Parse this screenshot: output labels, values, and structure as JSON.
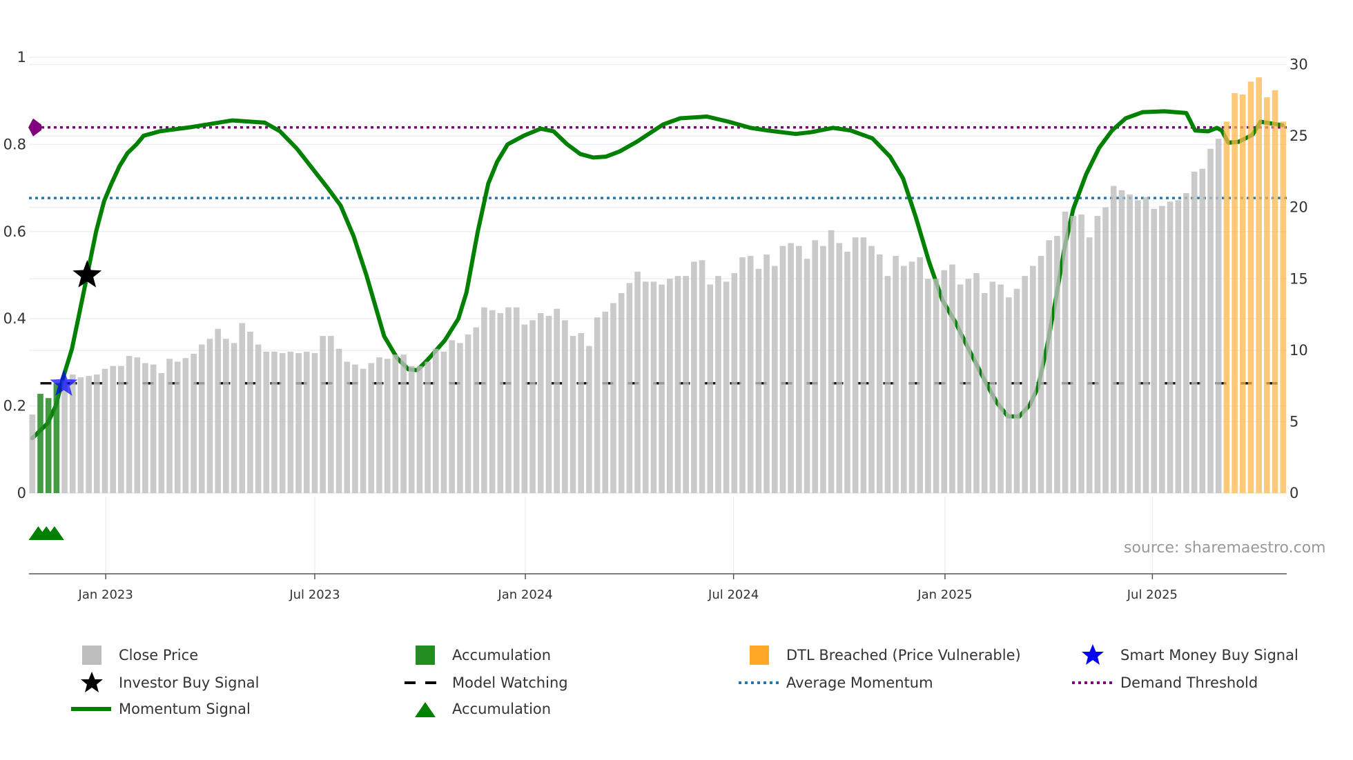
{
  "chart_data": {
    "type": "bar",
    "title": "",
    "xlabel": "",
    "ylabel_left": "",
    "ylabel_right": "",
    "x_unit": "week index (weekly bars, approx. Oct 2022 to Oct 2025)",
    "x_ticks": [
      {
        "label": "Jan 2023",
        "index": 9.1
      },
      {
        "label": "Jul 2023",
        "index": 35.0
      },
      {
        "label": "Jan 2024",
        "index": 61.1
      },
      {
        "label": "Jul 2024",
        "index": 86.9
      },
      {
        "label": "Jan 2025",
        "index": 113.1
      },
      {
        "label": "Jul 2025",
        "index": 138.8
      }
    ],
    "left_axis": {
      "range": [
        0,
        1
      ],
      "ticks": [
        "0",
        "0.2",
        "0.4",
        "0.6",
        "0.8",
        "1"
      ],
      "tick_values": [
        0,
        0.2,
        0.4,
        0.6,
        0.8,
        1
      ]
    },
    "right_axis": {
      "range": [
        0,
        30
      ],
      "ticks": [
        "0",
        "5",
        "10",
        "15",
        "20",
        "25",
        "30"
      ],
      "tick_values": [
        0,
        5,
        10,
        15,
        20,
        25,
        30
      ]
    },
    "grid": true,
    "close_prices": [
      5.5,
      6.95,
      6.65,
      7.7,
      7.9,
      8.3,
      8.1,
      8.2,
      8.3,
      8.7,
      8.9,
      8.9,
      9.6,
      9.5,
      9.1,
      9.0,
      8.4,
      9.4,
      9.2,
      9.45,
      9.75,
      10.4,
      10.8,
      11.5,
      10.8,
      10.5,
      11.9,
      11.3,
      10.4,
      9.9,
      9.9,
      9.8,
      9.9,
      9.8,
      9.9,
      9.8,
      11.0,
      11.0,
      10.1,
      9.2,
      9.0,
      8.7,
      9.1,
      9.5,
      9.4,
      9.7,
      9.7,
      8.9,
      8.9,
      9.2,
      10.1,
      9.9,
      10.7,
      10.5,
      11.1,
      11.6,
      13.0,
      12.8,
      12.6,
      13.0,
      13.0,
      11.8,
      12.1,
      12.6,
      12.4,
      12.9,
      12.1,
      11.0,
      11.2,
      10.3,
      12.3,
      12.7,
      13.3,
      14.0,
      14.7,
      15.5,
      14.8,
      14.8,
      14.6,
      15.0,
      15.2,
      15.2,
      16.2,
      16.3,
      14.6,
      15.2,
      14.8,
      15.4,
      16.5,
      16.6,
      15.7,
      16.7,
      15.9,
      17.3,
      17.5,
      17.3,
      16.4,
      17.7,
      17.3,
      18.4,
      17.5,
      16.9,
      17.9,
      17.9,
      17.3,
      16.7,
      15.2,
      16.6,
      15.9,
      16.2,
      16.5,
      15.0,
      15.0,
      15.6,
      16.0,
      14.6,
      15.0,
      15.4,
      14.0,
      14.8,
      14.6,
      13.7,
      14.3,
      15.2,
      15.9,
      16.6,
      17.7,
      18.0,
      19.7,
      19.4,
      19.5,
      17.9,
      19.4,
      20.0,
      21.5,
      21.2,
      20.9,
      20.5,
      20.7,
      19.9,
      20.1,
      20.4,
      20.5,
      21.0,
      22.5,
      22.7,
      24.1,
      24.8,
      26.0,
      28.0,
      27.9,
      28.8,
      29.1,
      27.7,
      28.2,
      26.0
    ],
    "accumulation_bars": [
      1,
      2,
      3
    ],
    "dtl_breached_bars": [
      148,
      149,
      150,
      151,
      152,
      153,
      154,
      155
    ],
    "momentum_signal": [
      [
        0,
        0.126
      ],
      [
        1.9,
        0.16
      ],
      [
        2.9,
        0.2
      ],
      [
        3.9,
        0.27
      ],
      [
        4.9,
        0.33
      ],
      [
        5.8,
        0.41
      ],
      [
        6.8,
        0.5
      ],
      [
        7.9,
        0.6
      ],
      [
        8.9,
        0.67
      ],
      [
        9.8,
        0.71
      ],
      [
        10.8,
        0.75
      ],
      [
        11.8,
        0.78
      ],
      [
        12.9,
        0.8
      ],
      [
        13.8,
        0.82
      ],
      [
        15.8,
        0.83
      ],
      [
        19.8,
        0.84
      ],
      [
        24.8,
        0.855
      ],
      [
        28.8,
        0.85
      ],
      [
        30.7,
        0.83
      ],
      [
        32.8,
        0.79
      ],
      [
        36.6,
        0.7
      ],
      [
        38.2,
        0.66
      ],
      [
        39.8,
        0.59
      ],
      [
        41.4,
        0.5
      ],
      [
        43.6,
        0.36
      ],
      [
        45.2,
        0.31
      ],
      [
        46.6,
        0.284
      ],
      [
        47.7,
        0.282
      ],
      [
        49.0,
        0.306
      ],
      [
        51.1,
        0.35
      ],
      [
        52.8,
        0.4
      ],
      [
        53.8,
        0.46
      ],
      [
        55.2,
        0.6
      ],
      [
        56.5,
        0.71
      ],
      [
        57.6,
        0.76
      ],
      [
        58.9,
        0.8
      ],
      [
        60.9,
        0.82
      ],
      [
        63.0,
        0.836
      ],
      [
        64.6,
        0.83
      ],
      [
        66.3,
        0.8
      ],
      [
        67.9,
        0.778
      ],
      [
        69.5,
        0.77
      ],
      [
        71.1,
        0.772
      ],
      [
        72.8,
        0.784
      ],
      [
        74.9,
        0.806
      ],
      [
        78.2,
        0.846
      ],
      [
        80.3,
        0.86
      ],
      [
        83.6,
        0.864
      ],
      [
        86.3,
        0.852
      ],
      [
        89.0,
        0.838
      ],
      [
        91.1,
        0.832
      ],
      [
        94.6,
        0.824
      ],
      [
        96.5,
        0.828
      ],
      [
        99.2,
        0.838
      ],
      [
        101.4,
        0.832
      ],
      [
        104.1,
        0.814
      ],
      [
        106.3,
        0.772
      ],
      [
        107.9,
        0.722
      ],
      [
        109.5,
        0.632
      ],
      [
        111.1,
        0.532
      ],
      [
        112.8,
        0.442
      ],
      [
        114.4,
        0.392
      ],
      [
        116.0,
        0.332
      ],
      [
        118.2,
        0.252
      ],
      [
        119.5,
        0.208
      ],
      [
        120.9,
        0.176
      ],
      [
        122.3,
        0.176
      ],
      [
        123.6,
        0.202
      ],
      [
        124.6,
        0.242
      ],
      [
        125.7,
        0.332
      ],
      [
        126.8,
        0.442
      ],
      [
        127.9,
        0.562
      ],
      [
        129.0,
        0.652
      ],
      [
        130.6,
        0.732
      ],
      [
        132.2,
        0.792
      ],
      [
        133.8,
        0.832
      ],
      [
        135.5,
        0.86
      ],
      [
        137.6,
        0.874
      ],
      [
        140.3,
        0.876
      ],
      [
        143.0,
        0.872
      ],
      [
        144.1,
        0.832
      ],
      [
        145.7,
        0.83
      ],
      [
        146.8,
        0.838
      ],
      [
        147.4,
        0.832
      ],
      [
        148.2,
        0.804
      ],
      [
        149.5,
        0.806
      ],
      [
        151.2,
        0.822
      ],
      [
        152.2,
        0.852
      ],
      [
        154.9,
        0.844
      ]
    ],
    "demand_threshold": 0.839,
    "average_momentum": 0.677,
    "model_watching": {
      "value": 0.252,
      "from_index": 1
    },
    "investor_buy_signals": [
      {
        "index": 6.8,
        "value": 0.5
      }
    ],
    "smart_money_buy_signals": [
      {
        "index": 3.9,
        "value": 0.25
      }
    ],
    "accumulation_markers": [
      1,
      2,
      3
    ],
    "annotation": "source: sharemaestro.com",
    "legend_placement": "bottom",
    "colors": {
      "close": "#bdbdbd",
      "accumulation_bar": "#228b22",
      "dtl": "#ffb74d",
      "momentum": "#008000",
      "investor_star": "#000000",
      "smart_star": "#0000ff",
      "model_watching": "#000000",
      "average_momentum": "#1f77b4",
      "demand_threshold": "#800080",
      "accumulation_marker": "#008000"
    }
  },
  "legend": [
    {
      "label": "Close Price",
      "icon": "square-gray"
    },
    {
      "label": "Accumulation",
      "icon": "square-green"
    },
    {
      "label": "DTL Breached (Price Vulnerable)",
      "icon": "square-orange"
    },
    {
      "label": "Smart Money Buy Signal",
      "icon": "star-blue"
    },
    {
      "label": "Investor Buy Signal",
      "icon": "star-black"
    },
    {
      "label": "Model Watching",
      "icon": "dash-black"
    },
    {
      "label": "Average Momentum",
      "icon": "dot-blue"
    },
    {
      "label": "Demand Threshold",
      "icon": "dot-purple"
    },
    {
      "label": "Momentum Signal",
      "icon": "line-green"
    },
    {
      "label": "Accumulation",
      "icon": "triangle-green"
    }
  ]
}
